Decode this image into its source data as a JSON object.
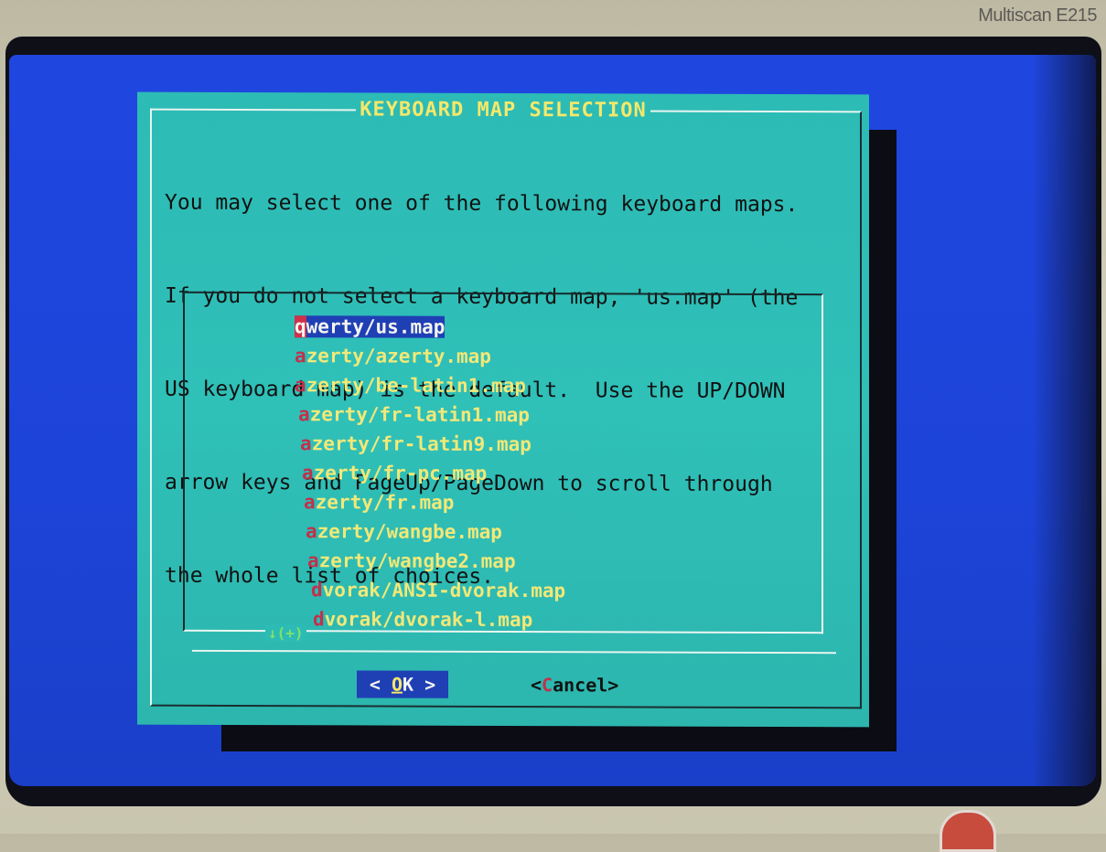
{
  "monitor": {
    "brand": "Multiscan E215"
  },
  "dialog": {
    "title": "KEYBOARD MAP SELECTION",
    "text_lines": [
      "You may select one of the following keyboard maps.",
      "If you do not select a keyboard map, 'us.map' (the",
      "US keyboard map) is the default.  Use the UP/DOWN",
      "arrow keys and PageUp/PageDown to scroll through",
      "the whole list of choices."
    ],
    "items": [
      {
        "hotkey": "q",
        "rest": "werty/us.map",
        "selected": true
      },
      {
        "hotkey": "a",
        "rest": "zerty/azerty.map",
        "selected": false
      },
      {
        "hotkey": "a",
        "rest": "zerty/be-latin1.map",
        "selected": false
      },
      {
        "hotkey": "a",
        "rest": "zerty/fr-latin1.map",
        "selected": false
      },
      {
        "hotkey": "a",
        "rest": "zerty/fr-latin9.map",
        "selected": false
      },
      {
        "hotkey": "a",
        "rest": "zerty/fr-pc.map",
        "selected": false
      },
      {
        "hotkey": "a",
        "rest": "zerty/fr.map",
        "selected": false
      },
      {
        "hotkey": "a",
        "rest": "zerty/wangbe.map",
        "selected": false
      },
      {
        "hotkey": "a",
        "rest": "zerty/wangbe2.map",
        "selected": false
      },
      {
        "hotkey": "d",
        "rest": "vorak/ANSI-dvorak.map",
        "selected": false
      },
      {
        "hotkey": "d",
        "rest": "vorak/dvorak-l.map",
        "selected": false
      }
    ],
    "scroll_indicator": "↓(+)",
    "ok": {
      "left": "<  ",
      "hot": "O",
      "rest": "K  >"
    },
    "cancel": {
      "left": "<",
      "hot": "C",
      "rest": "ancel>"
    }
  },
  "colors": {
    "screen_bg": "#1f47e0",
    "dialog_bg": "#2dbbb5",
    "title_text": "#f5e86a",
    "item_text": "#f2e878",
    "hotkey": "#c2304a",
    "selected_bg": "#1f3fb5",
    "scroll_indicator": "#7de36a"
  }
}
